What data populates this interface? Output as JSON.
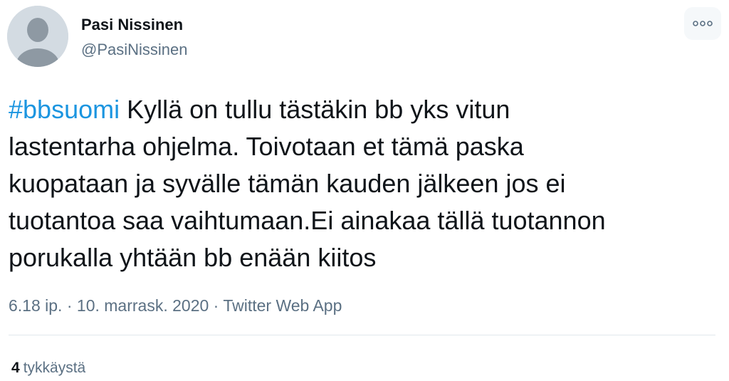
{
  "author": {
    "name": "Pasi Nissinen",
    "handle": "@PasiNissinen",
    "avatar_icon": "default-avatar-icon"
  },
  "more_icon": "more-options-icon",
  "tweet": {
    "hashtag": "#bbsuomi",
    "text": " Kyllä on tullu tästäkin bb yks vitun\nlastentarha ohjelma. Toivotaan et tämä paska\nkuopataan ja syvälle tämän kauden jälkeen jos ei\ntuotantoa saa vaihtumaan.Ei ainakaa tällä tuotannon\nporukalla yhtään bb enään kiitos"
  },
  "meta": {
    "time": "6.18 ip.",
    "separator": "·",
    "date": "10. marrask. 2020",
    "source": "Twitter Web App"
  },
  "stats": {
    "likes_count": "4",
    "likes_label": "tykkäystä"
  },
  "colors": {
    "link": "#1b95e0",
    "secondary_text": "#5b7083",
    "primary_text": "#0f1419",
    "divider": "#e1e8ed"
  }
}
